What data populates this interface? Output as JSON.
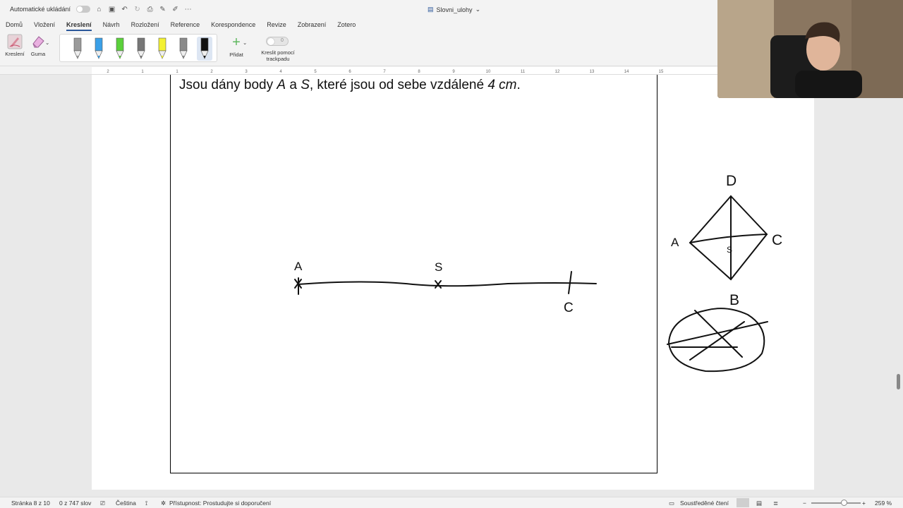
{
  "titlebar": {
    "autosave_label": "Automatické ukládání",
    "doc_title": "Slovni_ulohy"
  },
  "menu": {
    "tabs": [
      "Domů",
      "Vložení",
      "Kreslení",
      "Návrh",
      "Rozložení",
      "Reference",
      "Korespondence",
      "Revize",
      "Zobrazení",
      "Zotero"
    ],
    "active": "Kreslení"
  },
  "ribbon": {
    "draw_label": "Kreslení",
    "eraser_label": "Guma",
    "add_label": "Přidat",
    "trackpad_toggle_value": "0",
    "trackpad_label_line1": "Kreslit pomocí",
    "trackpad_label_line2": "trackpadu",
    "pens": [
      {
        "name": "pen-gray",
        "color": "#9a9a9a"
      },
      {
        "name": "pen-blue",
        "color": "#3aa0e8"
      },
      {
        "name": "pen-green",
        "color": "#5bd13b"
      },
      {
        "name": "pencil-gray",
        "color": "#777777"
      },
      {
        "name": "highlighter-yellow",
        "color": "#f3f132"
      },
      {
        "name": "pencil-dark",
        "color": "#8a8a8a"
      },
      {
        "name": "pen-black",
        "color": "#111111"
      }
    ]
  },
  "ruler": {
    "numbers": [
      "2",
      "1",
      "1",
      "2",
      "3",
      "4",
      "5",
      "6",
      "7",
      "8",
      "9",
      "10",
      "11",
      "12",
      "13",
      "14",
      "15"
    ]
  },
  "document": {
    "task_prefix": "Jsou dány body ",
    "task_A": "A",
    "task_mid1": " a ",
    "task_S": "S",
    "task_mid2": ", které jsou od sebe vzdálené ",
    "task_dist": "4 cm",
    "task_end": "."
  },
  "drawing": {
    "label_A": "A",
    "label_S": "S",
    "label_C": "C",
    "diamond_D": "D",
    "diamond_A": "A",
    "diamond_C": "C",
    "diamond_S": "S",
    "diamond_B": "B"
  },
  "status": {
    "page": "Stránka 8 z 10",
    "words": "0 z 747 slov",
    "language": "Čeština",
    "accessibility": "Přístupnost: Prostudujte si doporučení",
    "focus": "Soustředěné čtení",
    "zoom": "259 %"
  }
}
